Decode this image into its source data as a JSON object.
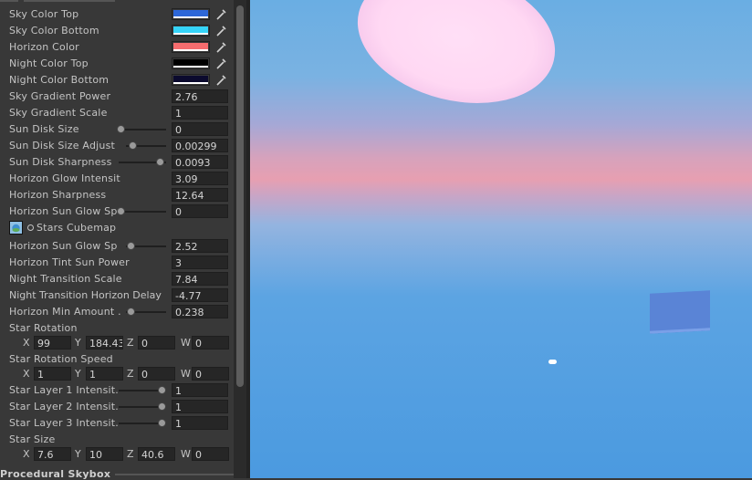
{
  "inspector": {
    "color_rows": [
      {
        "label": "Sky Color Top",
        "color": "#2d67d8"
      },
      {
        "label": "Sky Color Bottom",
        "color": "#35d4f8"
      },
      {
        "label": "Horizon Color",
        "color": "#f66c6e"
      },
      {
        "label": "Night Color Top",
        "color": "#000000"
      },
      {
        "label": "Night Color Bottom",
        "color": "#0b0a2e"
      }
    ],
    "sky_gradient_power": {
      "label": "Sky Gradient Power",
      "value": "2.76"
    },
    "sky_gradient_scale": {
      "label": "Sky Gradient Scale",
      "value": "1"
    },
    "sun_disk_size": {
      "label": "Sun Disk Size",
      "value": "0"
    },
    "sun_disk_size_adjust": {
      "label": "Sun Disk Size Adjust",
      "value": "0.00299"
    },
    "sun_disk_sharpness": {
      "label": "Sun Disk Sharpness",
      "value": "0.0093"
    },
    "horizon_glow_intensity": {
      "label": "Horizon Glow Intensit",
      "value": "3.09"
    },
    "horizon_sharpness": {
      "label": "Horizon Sharpness",
      "value": "12.64"
    },
    "horizon_sun_glow_spread": {
      "label": "Horizon Sun Glow Sp",
      "value": "0"
    },
    "stars_cubemap": {
      "label": "Stars Cubemap"
    },
    "horizon_sun_glow_spread2": {
      "label": "Horizon Sun Glow Sp",
      "value": "2.52"
    },
    "horizon_tint_sun_power": {
      "label": "Horizon Tint Sun Power",
      "value": "3"
    },
    "night_transition_scale": {
      "label": "Night Transition Scale",
      "value": "7.84"
    },
    "night_transition_horizon_delay": {
      "label": "Night Transition Horizon Delay",
      "value": "-4.77"
    },
    "horizon_min_amount": {
      "label": "Horizon Min Amount .",
      "value": "0.238"
    },
    "star_rotation": {
      "label": "Star Rotation",
      "x": "99",
      "y": "184.43",
      "z": "0",
      "w": "0"
    },
    "star_rotation_speed": {
      "label": "Star Rotation Speed",
      "x": "1",
      "y": "1",
      "z": "0",
      "w": "0"
    },
    "star_layer_1": {
      "label": "Star Layer 1 Intensit.",
      "value": "1"
    },
    "star_layer_2": {
      "label": "Star Layer 2 Intensit.",
      "value": "1"
    },
    "star_layer_3": {
      "label": "Star Layer 3 Intensit.",
      "value": "1"
    },
    "star_size": {
      "label": "Star Size",
      "x": "7.6",
      "y": "10",
      "z": "40.6",
      "w": "0"
    },
    "axis": {
      "x": "X",
      "y": "Y",
      "z": "Z",
      "w": "W"
    },
    "bottom_header": "Procedural Skybox"
  },
  "icons": {
    "color_picker": "eyedropper-icon",
    "cubemap": "cubemap-thumbnail-icon",
    "object_picker": "radio-circle-icon"
  }
}
